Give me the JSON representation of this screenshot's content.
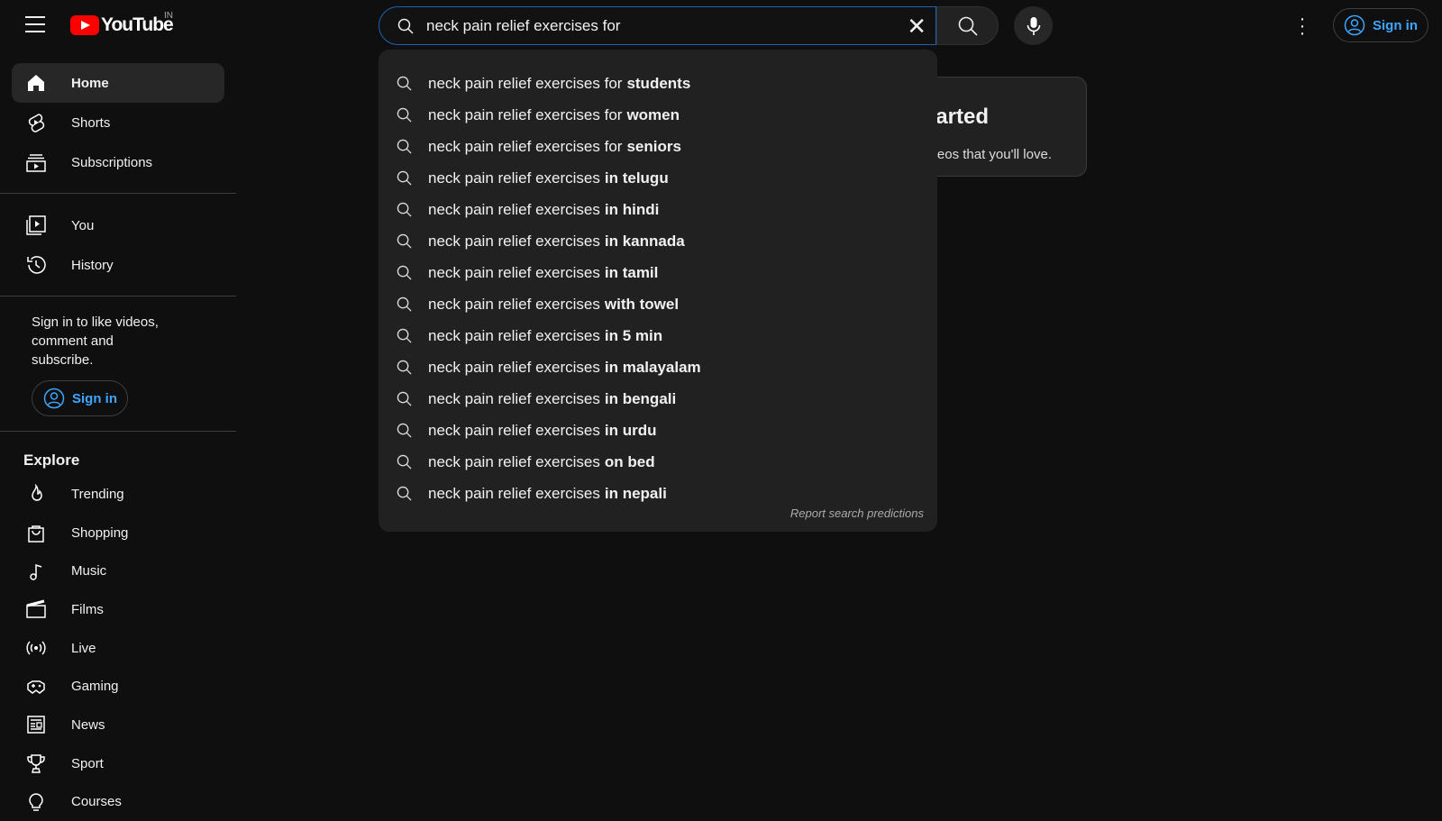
{
  "header": {
    "logo_text": "YouTube",
    "region": "IN",
    "search_value": "neck pain relief exercises for",
    "sign_in": "Sign in"
  },
  "sidebar": {
    "main": [
      {
        "label": "Home",
        "icon": "home-icon",
        "active": true
      },
      {
        "label": "Shorts",
        "icon": "shorts-icon"
      },
      {
        "label": "Subscriptions",
        "icon": "subscriptions-icon"
      }
    ],
    "you": [
      {
        "label": "You",
        "icon": "you-icon"
      },
      {
        "label": "History",
        "icon": "history-icon"
      }
    ],
    "signin_prompt": "Sign in to like videos, comment and subscribe.",
    "sign_in": "Sign in",
    "explore_title": "Explore",
    "explore": [
      {
        "label": "Trending",
        "icon": "trending-icon"
      },
      {
        "label": "Shopping",
        "icon": "shopping-icon"
      },
      {
        "label": "Music",
        "icon": "music-icon"
      },
      {
        "label": "Films",
        "icon": "films-icon"
      },
      {
        "label": "Live",
        "icon": "live-icon"
      },
      {
        "label": "Gaming",
        "icon": "gaming-icon"
      },
      {
        "label": "News",
        "icon": "news-icon"
      },
      {
        "label": "Sport",
        "icon": "sport-icon"
      },
      {
        "label": "Courses",
        "icon": "courses-icon"
      }
    ]
  },
  "card": {
    "title": "Try searching to get started",
    "text": "Start watching videos to help us build a feed of videos that you'll love."
  },
  "suggestions": {
    "prefix": "neck pain relief exercises",
    "items": [
      {
        "base": "neck pain relief exercises for",
        "bold": "students"
      },
      {
        "base": "neck pain relief exercises for",
        "bold": "women"
      },
      {
        "base": "neck pain relief exercises for",
        "bold": "seniors"
      },
      {
        "base": "neck pain relief exercises",
        "bold": "in telugu"
      },
      {
        "base": "neck pain relief exercises",
        "bold": "in hindi"
      },
      {
        "base": "neck pain relief exercises",
        "bold": "in kannada"
      },
      {
        "base": "neck pain relief exercises",
        "bold": "in tamil"
      },
      {
        "base": "neck pain relief exercises",
        "bold": "with towel"
      },
      {
        "base": "neck pain relief exercises",
        "bold": "in 5 min"
      },
      {
        "base": "neck pain relief exercises",
        "bold": "in malayalam"
      },
      {
        "base": "neck pain relief exercises",
        "bold": "in bengali"
      },
      {
        "base": "neck pain relief exercises",
        "bold": "in urdu"
      },
      {
        "base": "neck pain relief exercises",
        "bold": "on bed"
      },
      {
        "base": "neck pain relief exercises",
        "bold": "in nepali"
      }
    ],
    "report": "Report search predictions"
  },
  "colors": {
    "background": "#0f0f0f",
    "dropdown": "#212121",
    "accent": "#3ea6ff",
    "focus": "#1c62b9",
    "logo": "#ff0000"
  }
}
